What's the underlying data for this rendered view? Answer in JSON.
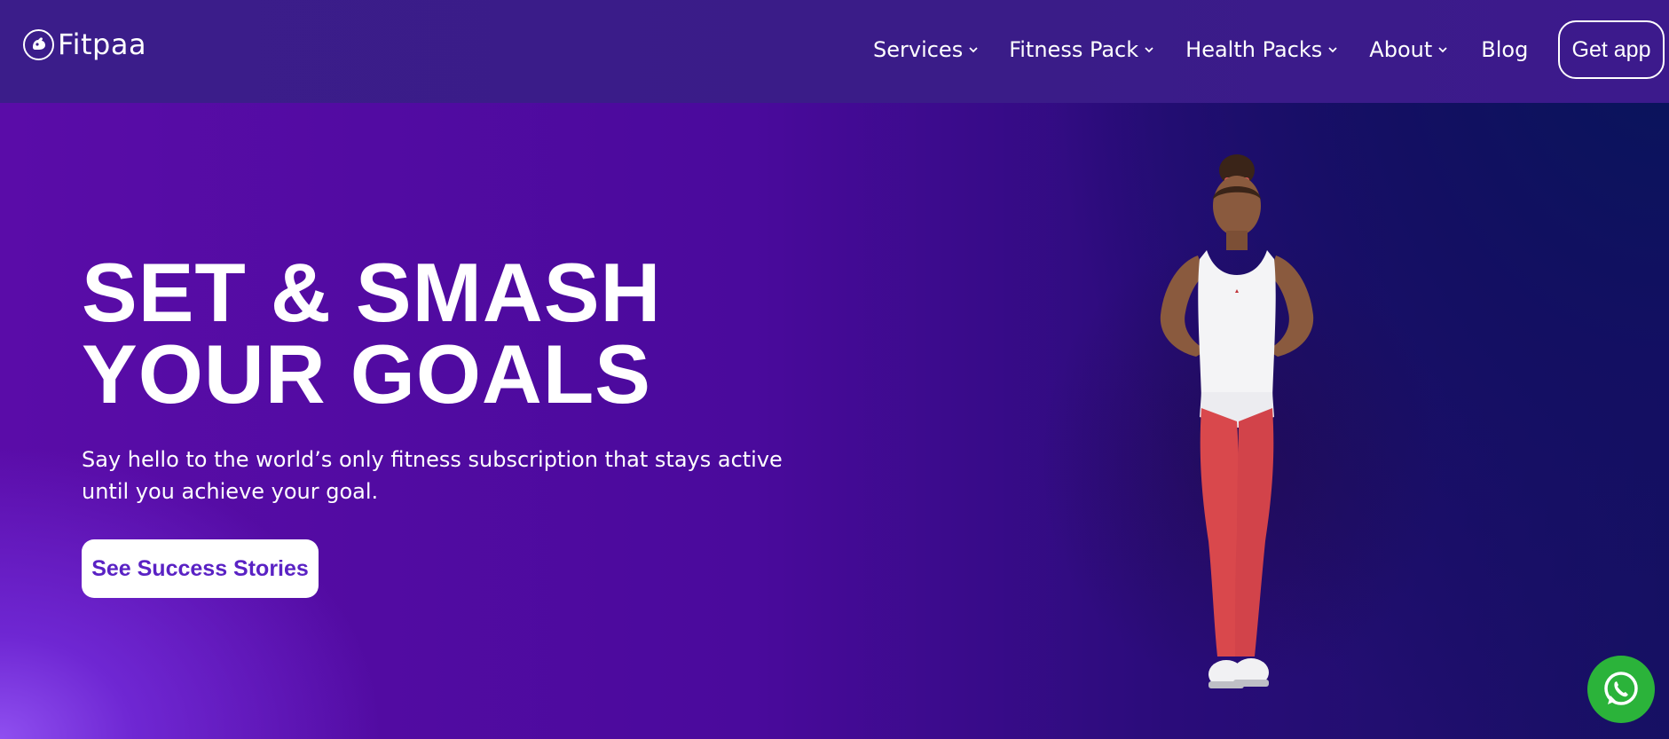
{
  "brand": {
    "name": "Fitpaa",
    "logo_icon": "flexing-arm-icon"
  },
  "nav": {
    "items": [
      {
        "label": "Services",
        "has_dropdown": true
      },
      {
        "label": "Fitness Pack",
        "has_dropdown": true
      },
      {
        "label": "Health Packs",
        "has_dropdown": true
      },
      {
        "label": "About",
        "has_dropdown": true
      },
      {
        "label": "Blog",
        "has_dropdown": false
      }
    ],
    "cta_label": "Get app"
  },
  "hero": {
    "title_line_1": "SET & SMASH",
    "title_line_2": "YOUR GOALS",
    "subtitle": "Say hello to the world’s only fitness subscription that stays active until you achieve your goal.",
    "button_label": "See Success Stories",
    "image_subject": "woman-in-white-tank-top-and-red-leggings"
  },
  "floating": {
    "whatsapp_icon": "whatsapp-icon"
  },
  "colors": {
    "nav_background": "#3a1c88",
    "hero_purple": "#4a0a9c",
    "cta_text": "#5a22c4",
    "whatsapp_green": "#2bb33a"
  }
}
